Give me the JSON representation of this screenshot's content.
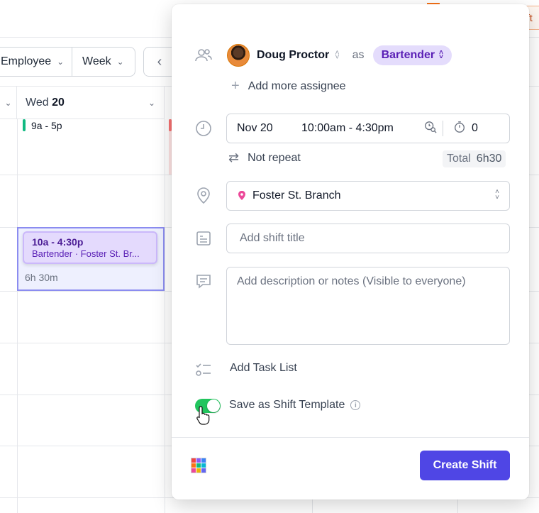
{
  "toolbar": {
    "employee_label": "Employee",
    "week_label": "Week",
    "prev_label": "‹",
    "peek_label": "ft"
  },
  "calendar": {
    "day_name": "Wed",
    "day_number": "20",
    "shift_small": "9a - 5p",
    "shift_card": {
      "time": "10a - 4:30p",
      "detail": "Bartender · Foster St. Br...",
      "duration": "6h 30m"
    }
  },
  "panel": {
    "assignee": {
      "name": "Doug Proctor",
      "as_label": "as",
      "role": "Bartender"
    },
    "add_more_assignee": "Add more assignee",
    "time": {
      "date": "Nov 20",
      "range": "10:00am -  4:30pm",
      "break_value": "0"
    },
    "repeat_label": "Not repeat",
    "total_label": "Total",
    "total_value": "6h30",
    "location": "Foster St. Branch",
    "shift_title_placeholder": "Add shift title",
    "description_placeholder": "Add description or notes (Visible to everyone)",
    "add_task_list": "Add Task List",
    "save_template_label": "Save as Shift Template",
    "save_template_on": true,
    "create_button": "Create Shift"
  },
  "colors": {
    "accent": "#4f46e5",
    "role_chip_bg": "#e4dcfc",
    "role_chip_text": "#5b21b6",
    "toggle_on": "#22c55e",
    "location_pin": "#ec4899"
  },
  "icons": [
    "people-icon",
    "clock-icon",
    "repeat-icon",
    "location-pin-icon",
    "shift-title-icon",
    "comment-icon",
    "task-list-icon",
    "info-icon",
    "color-grid-icon",
    "search-clock-icon",
    "timer-icon",
    "hand-cursor-icon"
  ]
}
